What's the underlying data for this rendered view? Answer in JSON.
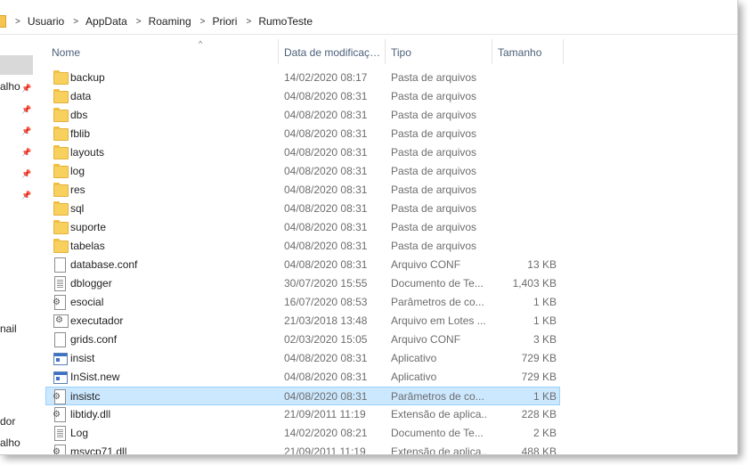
{
  "breadcrumb": [
    "Usuario",
    "AppData",
    "Roaming",
    "Priori",
    "RumoTeste"
  ],
  "columns": {
    "name": "Nome",
    "date": "Data de modificaç…",
    "type": "Tipo",
    "size": "Tamanho"
  },
  "nav": {
    "items": [
      "alho",
      "nail",
      "dor",
      "alho"
    ]
  },
  "files": [
    {
      "name": "backup",
      "date": "14/02/2020 08:17",
      "type": "Pasta de arquivos",
      "size": "",
      "icon": "folder-icon"
    },
    {
      "name": "data",
      "date": "04/08/2020 08:31",
      "type": "Pasta de arquivos",
      "size": "",
      "icon": "folder-icon"
    },
    {
      "name": "dbs",
      "date": "04/08/2020 08:31",
      "type": "Pasta de arquivos",
      "size": "",
      "icon": "folder-icon"
    },
    {
      "name": "fblib",
      "date": "04/08/2020 08:31",
      "type": "Pasta de arquivos",
      "size": "",
      "icon": "folder-icon"
    },
    {
      "name": "layouts",
      "date": "04/08/2020 08:31",
      "type": "Pasta de arquivos",
      "size": "",
      "icon": "folder-icon"
    },
    {
      "name": "log",
      "date": "04/08/2020 08:31",
      "type": "Pasta de arquivos",
      "size": "",
      "icon": "folder-icon"
    },
    {
      "name": "res",
      "date": "04/08/2020 08:31",
      "type": "Pasta de arquivos",
      "size": "",
      "icon": "folder-icon"
    },
    {
      "name": "sql",
      "date": "04/08/2020 08:31",
      "type": "Pasta de arquivos",
      "size": "",
      "icon": "folder-icon"
    },
    {
      "name": "suporte",
      "date": "04/08/2020 08:31",
      "type": "Pasta de arquivos",
      "size": "",
      "icon": "folder-icon"
    },
    {
      "name": "tabelas",
      "date": "04/08/2020 08:31",
      "type": "Pasta de arquivos",
      "size": "",
      "icon": "folder-icon"
    },
    {
      "name": "database.conf",
      "date": "04/08/2020 08:31",
      "type": "Arquivo CONF",
      "size": "13 KB",
      "icon": "file-icon"
    },
    {
      "name": "dblogger",
      "date": "30/07/2020 15:55",
      "type": "Documento de Te...",
      "size": "1,403 KB",
      "icon": "text-document-icon"
    },
    {
      "name": "esocial",
      "date": "16/07/2020 08:53",
      "type": "Parâmetros de co...",
      "size": "1 KB",
      "icon": "config-settings-icon"
    },
    {
      "name": "executador",
      "date": "21/03/2018 13:48",
      "type": "Arquivo em Lotes ...",
      "size": "1 KB",
      "icon": "batch-file-icon"
    },
    {
      "name": "grids.conf",
      "date": "02/03/2020 15:05",
      "type": "Arquivo CONF",
      "size": "3 KB",
      "icon": "file-icon"
    },
    {
      "name": "insist",
      "date": "04/08/2020 08:31",
      "type": "Aplicativo",
      "size": "729 KB",
      "icon": "application-icon"
    },
    {
      "name": "InSist.new",
      "date": "04/08/2020 08:31",
      "type": "Aplicativo",
      "size": "729 KB",
      "icon": "application-icon"
    },
    {
      "name": "insistc",
      "date": "04/08/2020 08:31",
      "type": "Parâmetros de co...",
      "size": "1 KB",
      "icon": "config-settings-icon",
      "selected": true
    },
    {
      "name": "libtidy.dll",
      "date": "21/09/2011 11:19",
      "type": "Extensão de aplica...",
      "size": "228 KB",
      "icon": "dll-file-icon"
    },
    {
      "name": "Log",
      "date": "14/02/2020 08:21",
      "type": "Documento de Te...",
      "size": "2 KB",
      "icon": "text-document-icon"
    },
    {
      "name": "msvcp71.dll",
      "date": "21/09/2011 11:19",
      "type": "Extensão de aplica...",
      "size": "488 KB",
      "icon": "dll-file-icon"
    }
  ]
}
